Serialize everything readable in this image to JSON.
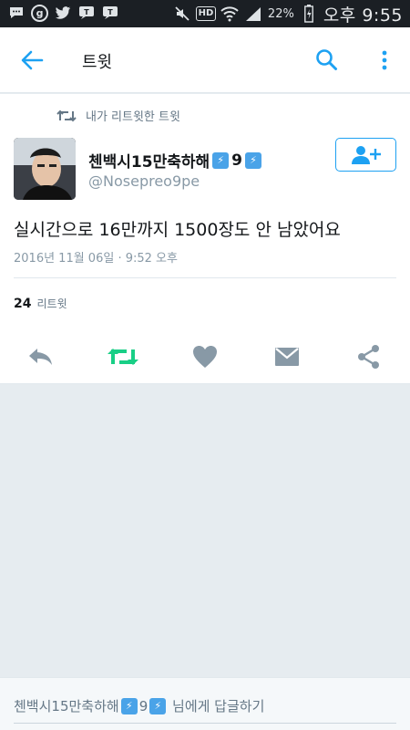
{
  "status_bar": {
    "battery": "22%",
    "clock": "오후 9:55",
    "hd_label": "HD",
    "icons": [
      "message-icon",
      "g-icon",
      "twitter-bird-icon",
      "talk-icon",
      "talk-icon",
      "mute-icon",
      "hd-icon",
      "wifi-icon",
      "signal-icon",
      "battery-icon"
    ]
  },
  "app_bar": {
    "title": "트윗",
    "back_icon": "back-arrow-icon",
    "search_icon": "search-icon",
    "more_icon": "more-vert-icon"
  },
  "tweet": {
    "retweet_context": "내가 리트윗한 트윗",
    "display_name": "첸백시15만축하해",
    "display_name_suffix": "9",
    "handle": "@Nosepreo9pe",
    "text": "실시간으로 16만까지 1500장도 안 남았어요",
    "timestamp": "2016년 11월 06일 · 9:52 오후",
    "retweet_count": "24",
    "retweet_label": "리트윗",
    "colors": {
      "accent": "#1da1f2",
      "retweet_green": "#19cf86",
      "icon_gray": "#8899a6"
    }
  },
  "actions": [
    {
      "name": "reply-icon"
    },
    {
      "name": "retweet-icon"
    },
    {
      "name": "like-heart-icon"
    },
    {
      "name": "direct-message-icon"
    },
    {
      "name": "share-icon"
    }
  ],
  "reply_bar": {
    "name": "첸백시15만축하해",
    "name_suffix": "9",
    "prompt_suffix": " 님에게 답글하기"
  }
}
